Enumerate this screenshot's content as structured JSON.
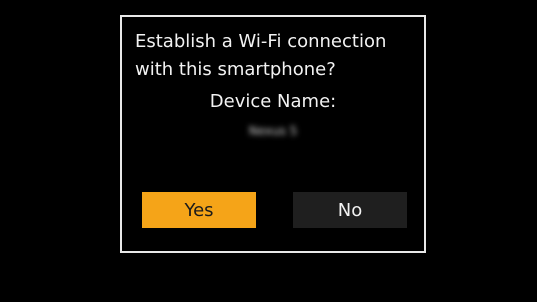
{
  "dialog": {
    "message_line1": "Establish a Wi-Fi connection",
    "message_line2": "with this smartphone?",
    "device_label": "Device Name:",
    "device_name": "Nexus 5"
  },
  "buttons": {
    "yes_label": "Yes",
    "no_label": "No"
  },
  "colors": {
    "background": "#000000",
    "dialog_border": "#e8e8e8",
    "selected_button": "#f5a418",
    "unselected_button": "#1f1f1f"
  },
  "state": {
    "selected_button": "Yes"
  }
}
